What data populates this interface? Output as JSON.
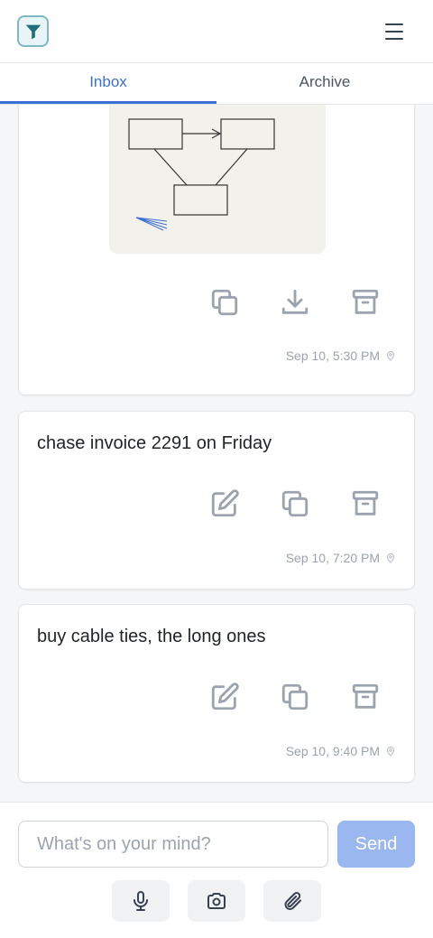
{
  "header": {
    "logo_icon": "funnel-logo-icon",
    "menu_icon": "hamburger-menu-icon"
  },
  "tabs": [
    {
      "label": "Inbox",
      "active": true
    },
    {
      "label": "Archive",
      "active": false
    }
  ],
  "cards": [
    {
      "type": "image",
      "actions": [
        "copy-icon",
        "download-icon",
        "archive-icon"
      ],
      "timestamp": "Sep 10, 5:30 PM"
    },
    {
      "type": "text",
      "text": "chase invoice 2291 on Friday",
      "actions": [
        "edit-icon",
        "copy-icon",
        "archive-icon"
      ],
      "timestamp": "Sep 10, 7:20 PM"
    },
    {
      "type": "text",
      "text": "buy cable ties, the long ones",
      "actions": [
        "edit-icon",
        "copy-icon",
        "archive-icon"
      ],
      "timestamp": "Sep 10, 9:40 PM"
    }
  ],
  "composer": {
    "placeholder": "What's on your mind?",
    "send_label": "Send",
    "tools": [
      "microphone-icon",
      "camera-icon",
      "paperclip-icon"
    ]
  },
  "colors": {
    "accent": "#3b6fd4",
    "send_button": "#9bb7f0",
    "icon_gray": "#9ca3af"
  }
}
